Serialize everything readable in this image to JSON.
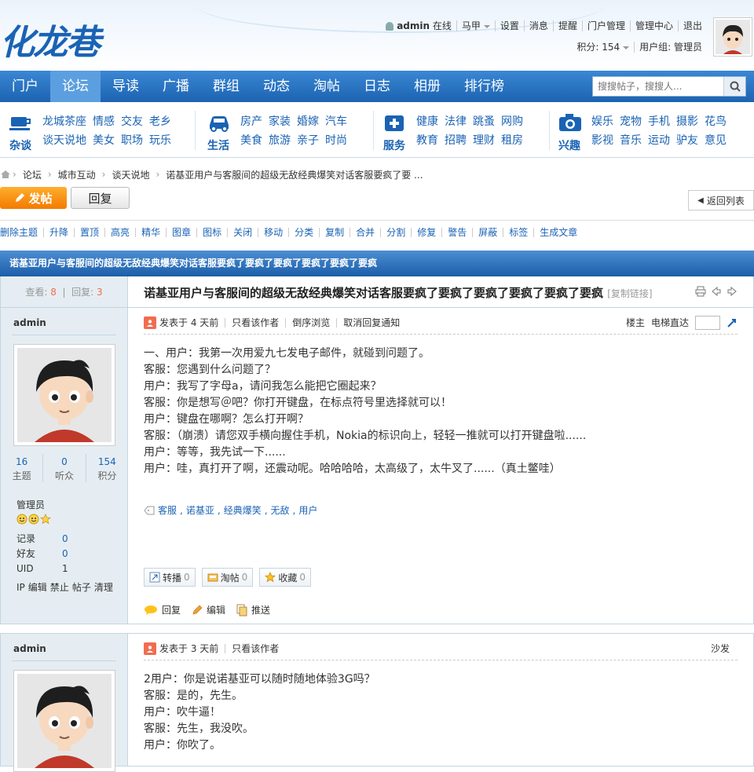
{
  "site": {
    "logo": "化龙巷"
  },
  "user": {
    "name": "admin",
    "status": "在线",
    "vest": "马甲",
    "links": [
      "设置",
      "消息",
      "提醒",
      "门户管理",
      "管理中心",
      "退出"
    ],
    "score": "积分: 154",
    "group": "用户组: 管理员"
  },
  "nav": {
    "items": [
      "门户",
      "论坛",
      "导读",
      "广播",
      "群组",
      "动态",
      "淘帖",
      "日志",
      "相册",
      "排行榜"
    ],
    "active": 1
  },
  "search": {
    "placeholder": "搜搜帖子，搜搜人..."
  },
  "categories": [
    {
      "name": "杂谈",
      "links": [
        "龙城茶座",
        "情感",
        "交友",
        "老乡",
        "谈天说地",
        "美女",
        "职场",
        "玩乐"
      ]
    },
    {
      "name": "生活",
      "links": [
        "房产",
        "家装",
        "婚嫁",
        "汽车",
        "美食",
        "旅游",
        "亲子",
        "时尚"
      ]
    },
    {
      "name": "服务",
      "links": [
        "健康",
        "法律",
        "跳蚤",
        "网购",
        "教育",
        "招聘",
        "理财",
        "租房"
      ]
    },
    {
      "name": "兴趣",
      "links": [
        "娱乐",
        "宠物",
        "手机",
        "摄影",
        "花鸟",
        "影视",
        "音乐",
        "运动",
        "驴友",
        "意见"
      ]
    }
  ],
  "breadcrumb": [
    "论坛",
    "城市互动",
    "谈天说地",
    "诺基亚用户与客服间的超级无敌经典爆笑对话客服要疯了要 ..."
  ],
  "buttons": {
    "post": "发帖",
    "reply": "回复",
    "back": "返回列表"
  },
  "moderation": [
    "删除主题",
    "升降",
    "置顶",
    "高亮",
    "精华",
    "图章",
    "图标",
    "关闭",
    "移动",
    "分类",
    "复制",
    "合并",
    "分割",
    "修复",
    "警告",
    "屏蔽",
    "标签",
    "生成文章"
  ],
  "thread": {
    "bar_title": "诺基亚用户与客服间的超级无敌经典爆笑对话客服要疯了要疯了要疯了要疯了要疯了要疯",
    "title": "诺基亚用户与客服间的超级无敌经典爆笑对话客服要疯了要疯了要疯了要疯了要疯了要疯",
    "copy_link": "[复制链接]",
    "views_label": "查看:",
    "views": "8",
    "replies_label": "回复:",
    "replies": "3"
  },
  "posts": [
    {
      "author": "admin",
      "stats": [
        {
          "num": "16",
          "label": "主题"
        },
        {
          "num": "0",
          "label": "听众"
        },
        {
          "num": "154",
          "label": "积分"
        }
      ],
      "group": "管理员",
      "info": [
        {
          "k": "记录",
          "v": "0"
        },
        {
          "k": "好友",
          "v": "0"
        },
        {
          "k": "UID",
          "v": "1"
        }
      ],
      "side_links": [
        "IP",
        "编辑",
        "禁止",
        "帖子",
        "清理"
      ],
      "posted": "发表于 4 天前",
      "meta": [
        "只看该作者",
        "倒序浏览",
        "取消回复通知"
      ],
      "floor": "楼主",
      "jump": "电梯直达",
      "lines": [
        "一、用户：我第一次用爱九七发电子邮件，就碰到问题了。",
        "客服：您遇到什么问题了？",
        "用户：我写了字母a，请问我怎么能把它圈起来？",
        "客服：你是想写＠吧？你打开键盘，在标点符号里选择就可以！",
        "用户：键盘在哪啊？怎么打开啊？",
        "客服：（崩溃）请您双手横向握住手机，Nokia的标识向上，轻轻一推就可以打开键盘啦......",
        "用户：等等，我先试一下......",
        "用户：哇，真打开了啊，还震动呢。哈哈哈哈，太高级了，太牛叉了......（真土鳖哇）"
      ],
      "tags": [
        "客服",
        "诺基亚",
        "经典爆笑",
        "无敌",
        "用户"
      ],
      "share": [
        {
          "label": "转播",
          "count": "0"
        },
        {
          "label": "淘帖",
          "count": "0"
        },
        {
          "label": "收藏",
          "count": "0"
        }
      ],
      "actions": [
        "回复",
        "编辑",
        "推送"
      ]
    },
    {
      "author": "admin",
      "posted": "发表于 3 天前",
      "meta": [
        "只看该作者"
      ],
      "floor": "沙发",
      "lines": [
        "2用户：你是说诺基亚可以随时随地体验3G吗？",
        "客服：是的，先生。",
        "用户：吹牛逼！",
        "客服：先生，我没吹。",
        "用户：你吹了。"
      ]
    }
  ],
  "colors": {
    "nav": "#1c63b1",
    "accent": "#1a63b4",
    "orange": "#f27b00"
  }
}
